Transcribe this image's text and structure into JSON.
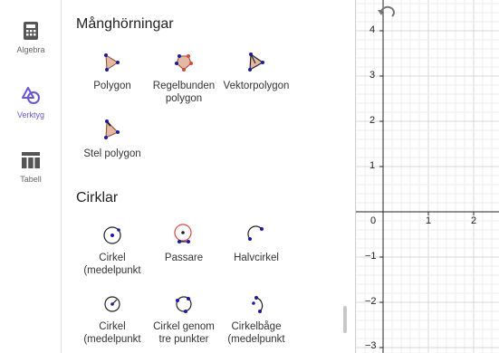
{
  "rail": {
    "items": [
      {
        "label": "Algebra",
        "icon": "calculator-icon"
      },
      {
        "label": "Verktyg",
        "icon": "tools-icon",
        "active": true
      },
      {
        "label": "Tabell",
        "icon": "table-icon"
      }
    ]
  },
  "sections": {
    "polygons": {
      "title": "Månghörningar",
      "tools": [
        {
          "label": "Polygon",
          "icon": "polygon-icon"
        },
        {
          "label": "Regelbunden polygon",
          "icon": "regular-polygon-icon"
        },
        {
          "label": "Vektorpolygon",
          "icon": "vector-polygon-icon"
        },
        {
          "label": "Stel polygon",
          "icon": "rigid-polygon-icon"
        }
      ]
    },
    "circles": {
      "title": "Cirklar",
      "tools": [
        {
          "label": "Cirkel (medelpunkt",
          "icon": "circle-center-point-icon"
        },
        {
          "label": "Passare",
          "icon": "compass-icon"
        },
        {
          "label": "Halvcirkel",
          "icon": "semicircle-icon"
        },
        {
          "label": "Cirkel (medelpunkt",
          "icon": "circle-center-radius-icon"
        },
        {
          "label": "Cirkel genom tre punkter",
          "icon": "circle-three-points-icon"
        },
        {
          "label": "Cirkelbåge (medelpunkt",
          "icon": "circular-arc-icon"
        }
      ]
    }
  },
  "graphics": {
    "x_ticks": [
      "0",
      "1",
      "2"
    ],
    "y_ticks": [
      "4",
      "3",
      "2",
      "1",
      "−1",
      "−2",
      "−3"
    ]
  },
  "colors": {
    "accent": "#6557d2",
    "point": "#1b1b9e",
    "polygon_fill": "#e3b9a6",
    "polygon_edge": "#8b4a2b",
    "compass_red": "#d9473f",
    "grid_minor": "#eeeeee",
    "grid_major": "#d8d8d8"
  }
}
